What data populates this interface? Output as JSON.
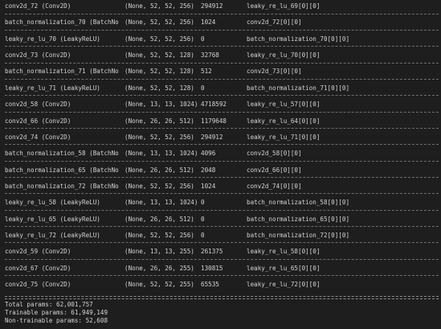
{
  "colors": {
    "background": "#1e1e1e",
    "text": "#d4d4d4",
    "separator": "#6e6e6e"
  },
  "layers": [
    {
      "layer": "conv2d_72 (Conv2D)",
      "shape": "(None, 52, 52, 256)",
      "params": "294912",
      "connected": "leaky_re_lu_69[0][0]"
    },
    {
      "layer": "batch_normalization_70 (BatchNo",
      "shape": "(None, 52, 52, 256)",
      "params": "1024",
      "connected": "conv2d_72[0][0]"
    },
    {
      "layer": "leaky_re_lu_70 (LeakyReLU)",
      "shape": "(None, 52, 52, 256)",
      "params": "0",
      "connected": "batch_normalization_70[0][0]"
    },
    {
      "layer": "conv2d_73 (Conv2D)",
      "shape": "(None, 52, 52, 128)",
      "params": "32768",
      "connected": "leaky_re_lu_70[0][0]"
    },
    {
      "layer": "batch_normalization_71 (BatchNo",
      "shape": "(None, 52, 52, 128)",
      "params": "512",
      "connected": "conv2d_73[0][0]"
    },
    {
      "layer": "leaky_re_lu_71 (LeakyReLU)",
      "shape": "(None, 52, 52, 128)",
      "params": "0",
      "connected": "batch_normalization_71[0][0]"
    },
    {
      "layer": "conv2d_58 (Conv2D)",
      "shape": "(None, 13, 13, 1024)",
      "params": "4718592",
      "connected": "leaky_re_lu_57[0][0]"
    },
    {
      "layer": "conv2d_66 (Conv2D)",
      "shape": "(None, 26, 26, 512)",
      "params": "1179648",
      "connected": "leaky_re_lu_64[0][0]"
    },
    {
      "layer": "conv2d_74 (Conv2D)",
      "shape": "(None, 52, 52, 256)",
      "params": "294912",
      "connected": "leaky_re_lu_71[0][0]"
    },
    {
      "layer": "batch_normalization_58 (BatchNo",
      "shape": "(None, 13, 13, 1024)",
      "params": "4096",
      "connected": "conv2d_58[0][0]"
    },
    {
      "layer": "batch_normalization_65 (BatchNo",
      "shape": "(None, 26, 26, 512)",
      "params": "2048",
      "connected": "conv2d_66[0][0]"
    },
    {
      "layer": "batch_normalization_72 (BatchNo",
      "shape": "(None, 52, 52, 256)",
      "params": "1024",
      "connected": "conv2d_74[0][0]"
    },
    {
      "layer": "leaky_re_lu_58 (LeakyReLU)",
      "shape": "(None, 13, 13, 1024)",
      "params": "0",
      "connected": "batch_normalization_58[0][0]"
    },
    {
      "layer": "leaky_re_lu_65 (LeakyReLU)",
      "shape": "(None, 26, 26, 512)",
      "params": "0",
      "connected": "batch_normalization_65[0][0]"
    },
    {
      "layer": "leaky_re_lu_72 (LeakyReLU)",
      "shape": "(None, 52, 52, 256)",
      "params": "0",
      "connected": "batch_normalization_72[0][0]"
    },
    {
      "layer": "conv2d_59 (Conv2D)",
      "shape": "(None, 13, 13, 255)",
      "params": "261375",
      "connected": "leaky_re_lu_58[0][0]"
    },
    {
      "layer": "conv2d_67 (Conv2D)",
      "shape": "(None, 26, 26, 255)",
      "params": "130815",
      "connected": "leaky_re_lu_65[0][0]"
    },
    {
      "layer": "conv2d_75 (Conv2D)",
      "shape": "(None, 52, 52, 255)",
      "params": "65535",
      "connected": "leaky_re_lu_72[0][0]"
    }
  ],
  "summary": {
    "total": "Total params: 62,001,757",
    "trainable": "Trainable params: 61,949,149",
    "non_trainable": "Non-trainable params: 52,608"
  }
}
